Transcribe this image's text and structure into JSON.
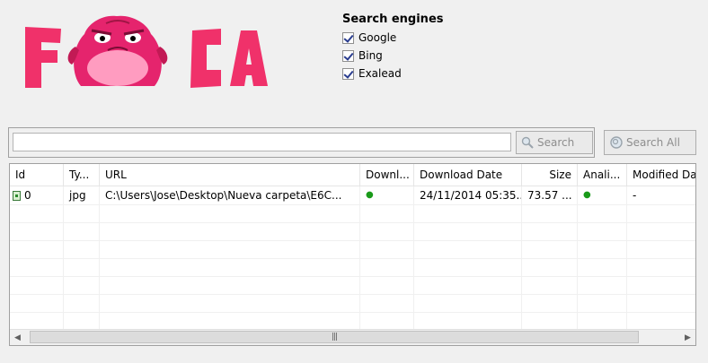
{
  "logo": {
    "text": "FOCA"
  },
  "search_engines": {
    "title": "Search engines",
    "options": [
      {
        "label": "Google",
        "checked": true
      },
      {
        "label": "Bing",
        "checked": true
      },
      {
        "label": "Exalead",
        "checked": true
      }
    ]
  },
  "search": {
    "query": "",
    "search_label": "Search",
    "search_all_label": "Search All"
  },
  "table": {
    "columns": [
      "Id",
      "Ty...",
      "URL",
      "Downl...",
      "Download Date",
      "Size",
      "Anali...",
      "Modified Da"
    ],
    "rows": [
      {
        "id": "0",
        "type": "jpg",
        "url": "C:\\Users\\Jose\\Desktop\\Nueva carpeta\\E6C...",
        "downloaded": "●",
        "download_date": "24/11/2014 05:35...",
        "size": "73.57 ...",
        "analyzed": "●",
        "modified": "-"
      }
    ]
  },
  "colors": {
    "logo_pink": "#f0316a",
    "status_green": "#1a9a1a"
  }
}
